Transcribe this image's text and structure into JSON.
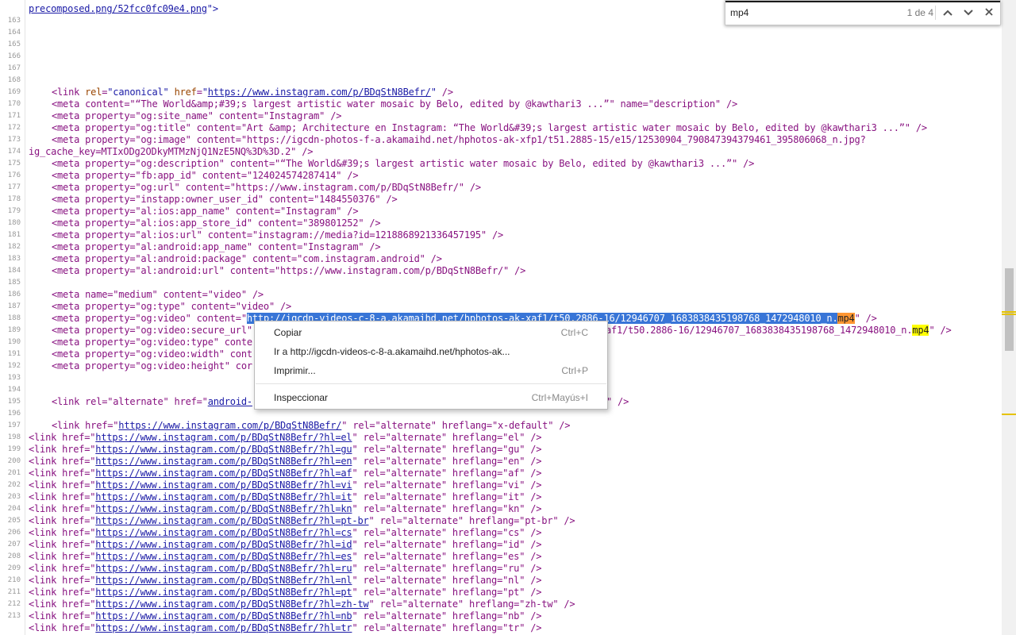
{
  "gutter": {
    "line_numbers": [
      "163",
      "164",
      "165",
      "166",
      "167",
      "168",
      "169",
      "170",
      "171",
      "172",
      "173",
      "174",
      "175",
      "176",
      "177",
      "178",
      "179",
      "180",
      "181",
      "182",
      "183",
      "184",
      "185",
      "186",
      "187",
      "188",
      "189",
      "190",
      "191",
      "192",
      "193",
      "194",
      "195",
      "196",
      "197",
      "198",
      "199",
      "200",
      "201",
      "202",
      "203",
      "204",
      "205",
      "206",
      "207",
      "208",
      "209",
      "210",
      "211",
      "212",
      "213"
    ]
  },
  "source": {
    "line0": "precomposed.png/52fcc0fc09e4.png",
    "canonical": "<link rel=\"canonical\" href=\"https://www.instagram.com/p/BDqStN8Befr/\" />",
    "canonical_href": "https://www.instagram.com/p/BDqStN8Befr/",
    "l171": "<meta content=\"“The World&amp;#39;s largest artistic water mosaic by Belo, edited by @kawthari3 ...”\" name=\"description\" />",
    "l172": "<meta property=\"og:site_name\" content=\"Instagram\" />",
    "l173": "<meta property=\"og:title\" content=\"Art &amp; Architecture en Instagram: “The World&#39;s largest artistic water mosaic by Belo, edited by @kawthari3 ...”\" />",
    "l174a": "<meta property=\"og:image\" content=\"https://igcdn-photos-f-a.akamaihd.net/hphotos-ak-xfp1/t51.2885-15/e15/12530904_790847394379461_395806068_n.jpg?",
    "l174b": "ig_cache_key=MTIxODg2ODkyMTMzNjQ1NzE5NQ%3D%3D.2\" />",
    "l175": "<meta property=\"og:description\" content=\"“The World&#39;s largest artistic water mosaic by Belo, edited by @kawthari3 ...”\" />",
    "l176": "<meta property=\"fb:app_id\" content=\"124024574287414\" />",
    "l177": "<meta property=\"og:url\" content=\"https://www.instagram.com/p/BDqStN8Befr/\" />",
    "l178": "<meta property=\"instapp:owner_user_id\" content=\"1484550376\" />",
    "l179": "<meta property=\"al:ios:app_name\" content=\"Instagram\" />",
    "l180": "<meta property=\"al:ios:app_store_id\" content=\"389801252\" />",
    "l181": "<meta property=\"al:ios:url\" content=\"instagram://media?id=1218868921336457195\" />",
    "l182": "<meta property=\"al:android:app_name\" content=\"Instagram\" />",
    "l183": "<meta property=\"al:android:package\" content=\"com.instagram.android\" />",
    "l184": "<meta property=\"al:android:url\" content=\"https://www.instagram.com/p/BDqStN8Befr/\" />",
    "l186": "<meta name=\"medium\" content=\"video\" />",
    "l187": "<meta property=\"og:type\" content=\"video\" />",
    "l188_pre": "<meta property=\"og:video\" content=\"",
    "l188_sel": "http://igcdn-videos-c-8-a.akamaihd.net/hphotos-ak-xaf1/t50.2886-16/12946707_1683838435198768_1472948010_n.",
    "l188_hit": "mp4",
    "l188_post": "\" />",
    "l189_pre": "<meta property=\"og:video:secure_url\"",
    "l189_tail": "af1/t50.2886-16/12946707_1683838435198768_1472948010_n.",
    "l189_hit": "mp4",
    "l189_post": "\" />",
    "l190": "<meta property=\"og:video:type\" conte",
    "l191": "<meta property=\"og:video:width\" cont",
    "l192": "<meta property=\"og:video:height\" cor",
    "l195_pre": "<link rel=\"alternate\" href=\"",
    "l195_href": "android-",
    "l195_post": "\" />",
    "l197_pre": "<link href=\"",
    "l197_href": "https://www.instagram.com/p/BDqStN8Befr/",
    "l197_post": "\" rel=\"alternate\" hreflang=\"x-default\" />",
    "alternates": [
      {
        "href": "https://www.instagram.com/p/BDqStN8Befr/?hl=el",
        "lang": "el"
      },
      {
        "href": "https://www.instagram.com/p/BDqStN8Befr/?hl=gu",
        "lang": "gu"
      },
      {
        "href": "https://www.instagram.com/p/BDqStN8Befr/?hl=en",
        "lang": "en"
      },
      {
        "href": "https://www.instagram.com/p/BDqStN8Befr/?hl=af",
        "lang": "af"
      },
      {
        "href": "https://www.instagram.com/p/BDqStN8Befr/?hl=vi",
        "lang": "vi"
      },
      {
        "href": "https://www.instagram.com/p/BDqStN8Befr/?hl=it",
        "lang": "it"
      },
      {
        "href": "https://www.instagram.com/p/BDqStN8Befr/?hl=kn",
        "lang": "kn"
      },
      {
        "href": "https://www.instagram.com/p/BDqStN8Befr/?hl=pt-br",
        "lang": "pt-br"
      },
      {
        "href": "https://www.instagram.com/p/BDqStN8Befr/?hl=cs",
        "lang": "cs"
      },
      {
        "href": "https://www.instagram.com/p/BDqStN8Befr/?hl=id",
        "lang": "id"
      },
      {
        "href": "https://www.instagram.com/p/BDqStN8Befr/?hl=es",
        "lang": "es"
      },
      {
        "href": "https://www.instagram.com/p/BDqStN8Befr/?hl=ru",
        "lang": "ru"
      },
      {
        "href": "https://www.instagram.com/p/BDqStN8Befr/?hl=nl",
        "lang": "nl"
      },
      {
        "href": "https://www.instagram.com/p/BDqStN8Befr/?hl=pt",
        "lang": "pt"
      },
      {
        "href": "https://www.instagram.com/p/BDqStN8Befr/?hl=zh-tw",
        "lang": "zh-tw"
      },
      {
        "href": "https://www.instagram.com/p/BDqStN8Befr/?hl=nb",
        "lang": "nb"
      },
      {
        "href": "https://www.instagram.com/p/BDqStN8Befr/?hl=tr",
        "lang": "tr"
      }
    ]
  },
  "find_bar": {
    "query": "mp4",
    "count": "1 de 4",
    "prev_icon": "chevron-up-icon",
    "next_icon": "chevron-down-icon",
    "close_icon": "close-icon",
    "accent_color": "#1a1a1a"
  },
  "context_menu": {
    "copy_label": "Copiar",
    "copy_shortcut": "Ctrl+C",
    "goto_label": "Ir a http://igcdn-videos-c-8-a.akamaihd.net/hphotos-ak...",
    "print_label": "Imprimir...",
    "print_shortcut": "Ctrl+P",
    "inspect_label": "Inspeccionar",
    "inspect_shortcut": "Ctrl+Mayús+I"
  },
  "colors": {
    "selection": "#3875d7",
    "match_highlight": "#ffff00",
    "active_match": "#ff9632",
    "tag": "#881280",
    "attribute_name": "#994500",
    "attribute_value": "#1a1aa6"
  }
}
